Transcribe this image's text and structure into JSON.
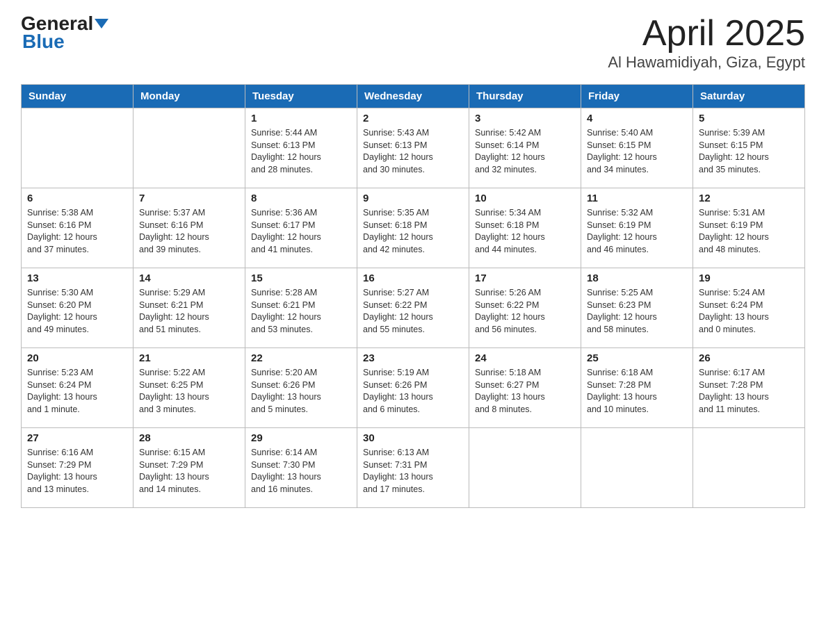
{
  "header": {
    "logo_general": "General",
    "logo_blue": "Blue",
    "title": "April 2025",
    "subtitle": "Al Hawamidiyah, Giza, Egypt"
  },
  "weekdays": [
    "Sunday",
    "Monday",
    "Tuesday",
    "Wednesday",
    "Thursday",
    "Friday",
    "Saturday"
  ],
  "weeks": [
    [
      {
        "day": "",
        "info": ""
      },
      {
        "day": "",
        "info": ""
      },
      {
        "day": "1",
        "info": "Sunrise: 5:44 AM\nSunset: 6:13 PM\nDaylight: 12 hours\nand 28 minutes."
      },
      {
        "day": "2",
        "info": "Sunrise: 5:43 AM\nSunset: 6:13 PM\nDaylight: 12 hours\nand 30 minutes."
      },
      {
        "day": "3",
        "info": "Sunrise: 5:42 AM\nSunset: 6:14 PM\nDaylight: 12 hours\nand 32 minutes."
      },
      {
        "day": "4",
        "info": "Sunrise: 5:40 AM\nSunset: 6:15 PM\nDaylight: 12 hours\nand 34 minutes."
      },
      {
        "day": "5",
        "info": "Sunrise: 5:39 AM\nSunset: 6:15 PM\nDaylight: 12 hours\nand 35 minutes."
      }
    ],
    [
      {
        "day": "6",
        "info": "Sunrise: 5:38 AM\nSunset: 6:16 PM\nDaylight: 12 hours\nand 37 minutes."
      },
      {
        "day": "7",
        "info": "Sunrise: 5:37 AM\nSunset: 6:16 PM\nDaylight: 12 hours\nand 39 minutes."
      },
      {
        "day": "8",
        "info": "Sunrise: 5:36 AM\nSunset: 6:17 PM\nDaylight: 12 hours\nand 41 minutes."
      },
      {
        "day": "9",
        "info": "Sunrise: 5:35 AM\nSunset: 6:18 PM\nDaylight: 12 hours\nand 42 minutes."
      },
      {
        "day": "10",
        "info": "Sunrise: 5:34 AM\nSunset: 6:18 PM\nDaylight: 12 hours\nand 44 minutes."
      },
      {
        "day": "11",
        "info": "Sunrise: 5:32 AM\nSunset: 6:19 PM\nDaylight: 12 hours\nand 46 minutes."
      },
      {
        "day": "12",
        "info": "Sunrise: 5:31 AM\nSunset: 6:19 PM\nDaylight: 12 hours\nand 48 minutes."
      }
    ],
    [
      {
        "day": "13",
        "info": "Sunrise: 5:30 AM\nSunset: 6:20 PM\nDaylight: 12 hours\nand 49 minutes."
      },
      {
        "day": "14",
        "info": "Sunrise: 5:29 AM\nSunset: 6:21 PM\nDaylight: 12 hours\nand 51 minutes."
      },
      {
        "day": "15",
        "info": "Sunrise: 5:28 AM\nSunset: 6:21 PM\nDaylight: 12 hours\nand 53 minutes."
      },
      {
        "day": "16",
        "info": "Sunrise: 5:27 AM\nSunset: 6:22 PM\nDaylight: 12 hours\nand 55 minutes."
      },
      {
        "day": "17",
        "info": "Sunrise: 5:26 AM\nSunset: 6:22 PM\nDaylight: 12 hours\nand 56 minutes."
      },
      {
        "day": "18",
        "info": "Sunrise: 5:25 AM\nSunset: 6:23 PM\nDaylight: 12 hours\nand 58 minutes."
      },
      {
        "day": "19",
        "info": "Sunrise: 5:24 AM\nSunset: 6:24 PM\nDaylight: 13 hours\nand 0 minutes."
      }
    ],
    [
      {
        "day": "20",
        "info": "Sunrise: 5:23 AM\nSunset: 6:24 PM\nDaylight: 13 hours\nand 1 minute."
      },
      {
        "day": "21",
        "info": "Sunrise: 5:22 AM\nSunset: 6:25 PM\nDaylight: 13 hours\nand 3 minutes."
      },
      {
        "day": "22",
        "info": "Sunrise: 5:20 AM\nSunset: 6:26 PM\nDaylight: 13 hours\nand 5 minutes."
      },
      {
        "day": "23",
        "info": "Sunrise: 5:19 AM\nSunset: 6:26 PM\nDaylight: 13 hours\nand 6 minutes."
      },
      {
        "day": "24",
        "info": "Sunrise: 5:18 AM\nSunset: 6:27 PM\nDaylight: 13 hours\nand 8 minutes."
      },
      {
        "day": "25",
        "info": "Sunrise: 6:18 AM\nSunset: 7:28 PM\nDaylight: 13 hours\nand 10 minutes."
      },
      {
        "day": "26",
        "info": "Sunrise: 6:17 AM\nSunset: 7:28 PM\nDaylight: 13 hours\nand 11 minutes."
      }
    ],
    [
      {
        "day": "27",
        "info": "Sunrise: 6:16 AM\nSunset: 7:29 PM\nDaylight: 13 hours\nand 13 minutes."
      },
      {
        "day": "28",
        "info": "Sunrise: 6:15 AM\nSunset: 7:29 PM\nDaylight: 13 hours\nand 14 minutes."
      },
      {
        "day": "29",
        "info": "Sunrise: 6:14 AM\nSunset: 7:30 PM\nDaylight: 13 hours\nand 16 minutes."
      },
      {
        "day": "30",
        "info": "Sunrise: 6:13 AM\nSunset: 7:31 PM\nDaylight: 13 hours\nand 17 minutes."
      },
      {
        "day": "",
        "info": ""
      },
      {
        "day": "",
        "info": ""
      },
      {
        "day": "",
        "info": ""
      }
    ]
  ]
}
